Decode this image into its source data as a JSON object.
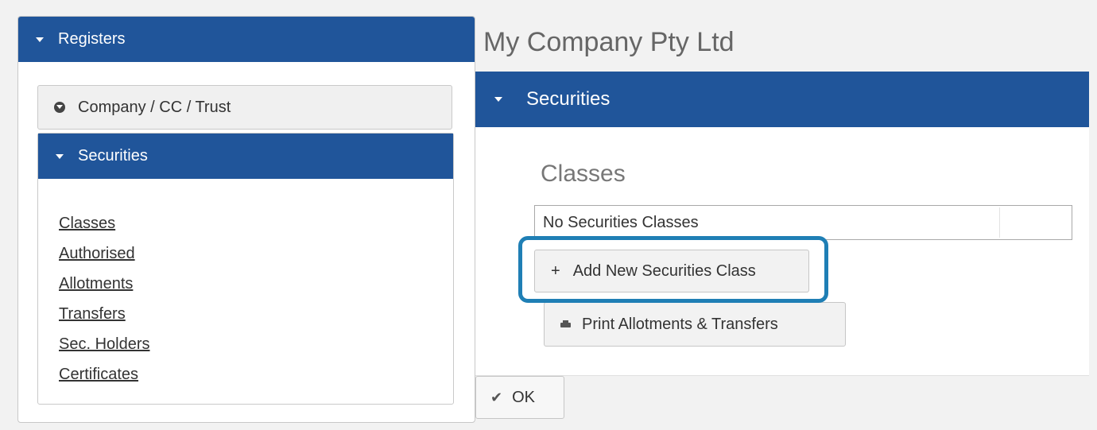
{
  "left_panel": {
    "header": "Registers",
    "company_button": "Company / CC / Trust",
    "securities_header": "Securities",
    "links": [
      "Classes",
      "Authorised",
      "Allotments",
      "Transfers",
      "Sec. Holders",
      "Certificates"
    ]
  },
  "main": {
    "company_name": "My Company Pty Ltd",
    "section_header": "Securities",
    "classes_heading": "Classes",
    "classes_empty": "No Securities Classes",
    "add_button": "Add New Securities Class",
    "print_button": "Print Allotments & Transfers",
    "ok_button": "OK"
  },
  "colors": {
    "header_blue": "#20559a",
    "highlight": "#1f7fb5"
  },
  "icons": {
    "caret": "caret-down-icon",
    "company": "circle-arrow-down-icon",
    "add": "plus-icon",
    "print": "printer-icon",
    "ok": "check-icon"
  }
}
